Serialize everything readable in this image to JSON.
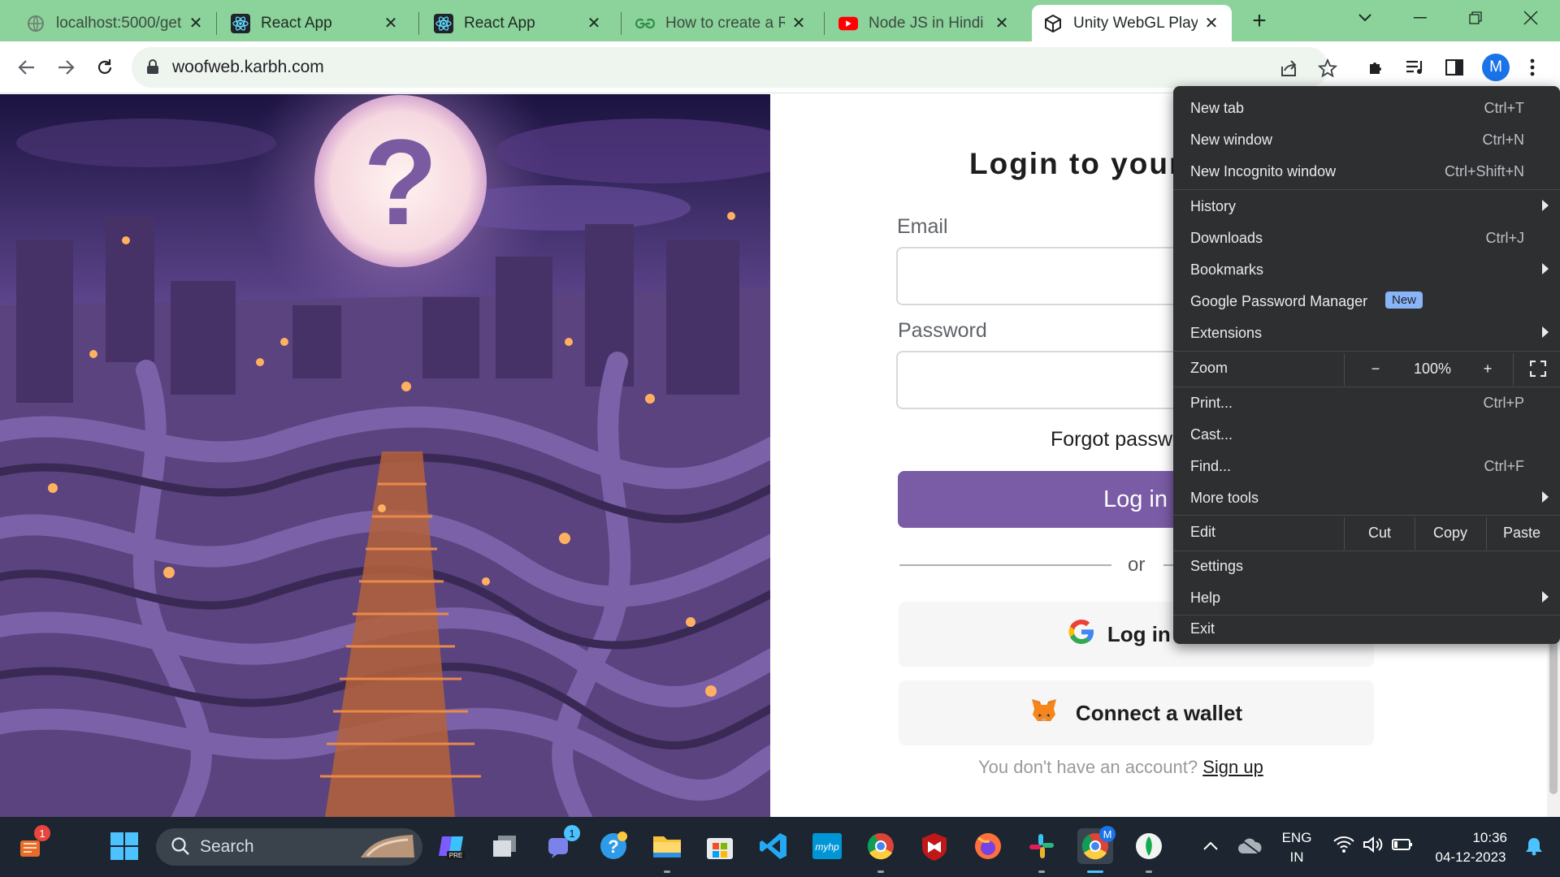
{
  "browser": {
    "tabs": [
      {
        "title": "localhost:5000/get",
        "favicon": "globe-icon",
        "active": false
      },
      {
        "title": "React App",
        "favicon": "react-icon",
        "active": false
      },
      {
        "title": "React App",
        "favicon": "react-icon",
        "active": false
      },
      {
        "title": "How to create a Re",
        "favicon": "geeksforgeeks-icon",
        "active": false
      },
      {
        "title": "Node JS in Hindi #",
        "favicon": "youtube-icon",
        "active": false
      },
      {
        "title": "Unity WebGL Playe",
        "favicon": "unity-icon",
        "active": true
      }
    ],
    "url": "woofweb.karbh.com",
    "profile_initial": "M",
    "tabstrip_color": "#8bd39a"
  },
  "page": {
    "title": "Login to your",
    "email_label": "Email",
    "email_value": "",
    "password_label": "Password",
    "password_value": "",
    "forgot_text": "Forgot passw",
    "login_button": "Log in",
    "divider_text": "or",
    "google_button": "Log in wit",
    "wallet_button": "Connect a wallet",
    "signup_prompt": "You don't have an account?",
    "signup_link": "Sign up",
    "accent_color": "#7a5ca6",
    "hero_image": "purple-maze-fantasy-illustration"
  },
  "menu": {
    "items": [
      {
        "label": "New tab",
        "shortcut": "Ctrl+T"
      },
      {
        "label": "New window",
        "shortcut": "Ctrl+N"
      },
      {
        "label": "New Incognito window",
        "shortcut": "Ctrl+Shift+N"
      },
      {
        "label": "History",
        "shortcut": ""
      },
      {
        "label": "Downloads",
        "shortcut": "Ctrl+J"
      },
      {
        "label": "Bookmarks",
        "shortcut": ""
      },
      {
        "label": "Google Password Manager",
        "shortcut": "",
        "badge": "New"
      },
      {
        "label": "Extensions",
        "shortcut": ""
      },
      {
        "label": "Zoom",
        "shortcut": ""
      },
      {
        "label": "Print...",
        "shortcut": "Ctrl+P"
      },
      {
        "label": "Cast...",
        "shortcut": ""
      },
      {
        "label": "Find...",
        "shortcut": "Ctrl+F"
      },
      {
        "label": "More tools",
        "shortcut": ""
      },
      {
        "label": "Edit",
        "shortcut": ""
      },
      {
        "label": "Settings",
        "shortcut": ""
      },
      {
        "label": "Help",
        "shortcut": ""
      },
      {
        "label": "Exit",
        "shortcut": ""
      }
    ],
    "zoom": {
      "minus": "−",
      "level": "100%",
      "plus": "+"
    },
    "edit": {
      "cut": "Cut",
      "copy": "Copy",
      "paste": "Paste"
    }
  },
  "taskbar": {
    "search_placeholder": "Search",
    "widgets_badge": "1",
    "teams_badge": "1",
    "language": "ENG",
    "region": "IN",
    "time": "10:36",
    "date": "04-12-2023",
    "chrome_profile_badge": "M"
  }
}
